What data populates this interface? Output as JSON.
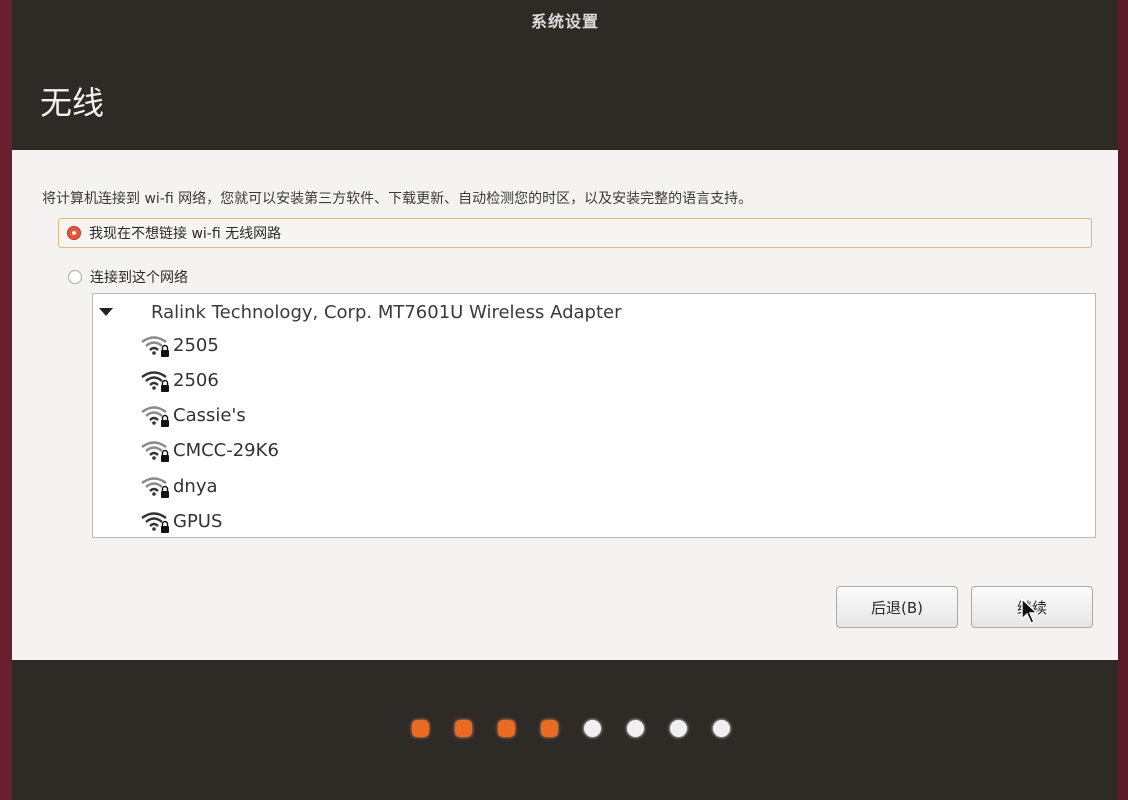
{
  "window": {
    "title": "系统设置"
  },
  "page": {
    "title": "无线"
  },
  "intro_text": "将计算机连接到 wi-fi 网络，您就可以安装第三方软件、下载更新、自动检测您的时区，以及安装完整的语言支持。",
  "options": {
    "no_wifi_label": "我现在不想链接 wi-fi 无线网路",
    "connect_label": "连接到这个网络"
  },
  "network_list": {
    "adapter": "Ralink Technology, Corp. MT7601U Wireless Adapter",
    "networks": [
      "2505",
      "2506",
      "Cassie's",
      "CMCC-29K6",
      "dnya",
      "GPUS"
    ]
  },
  "buttons": {
    "back_label": "后退(B)",
    "continue_label": "继续"
  },
  "progress": {
    "completed_steps": 4,
    "total_steps": 8
  },
  "colors": {
    "accent": "#e9543a",
    "progress_done": "#e86a25",
    "progress_todo": "#f0f0f0"
  }
}
